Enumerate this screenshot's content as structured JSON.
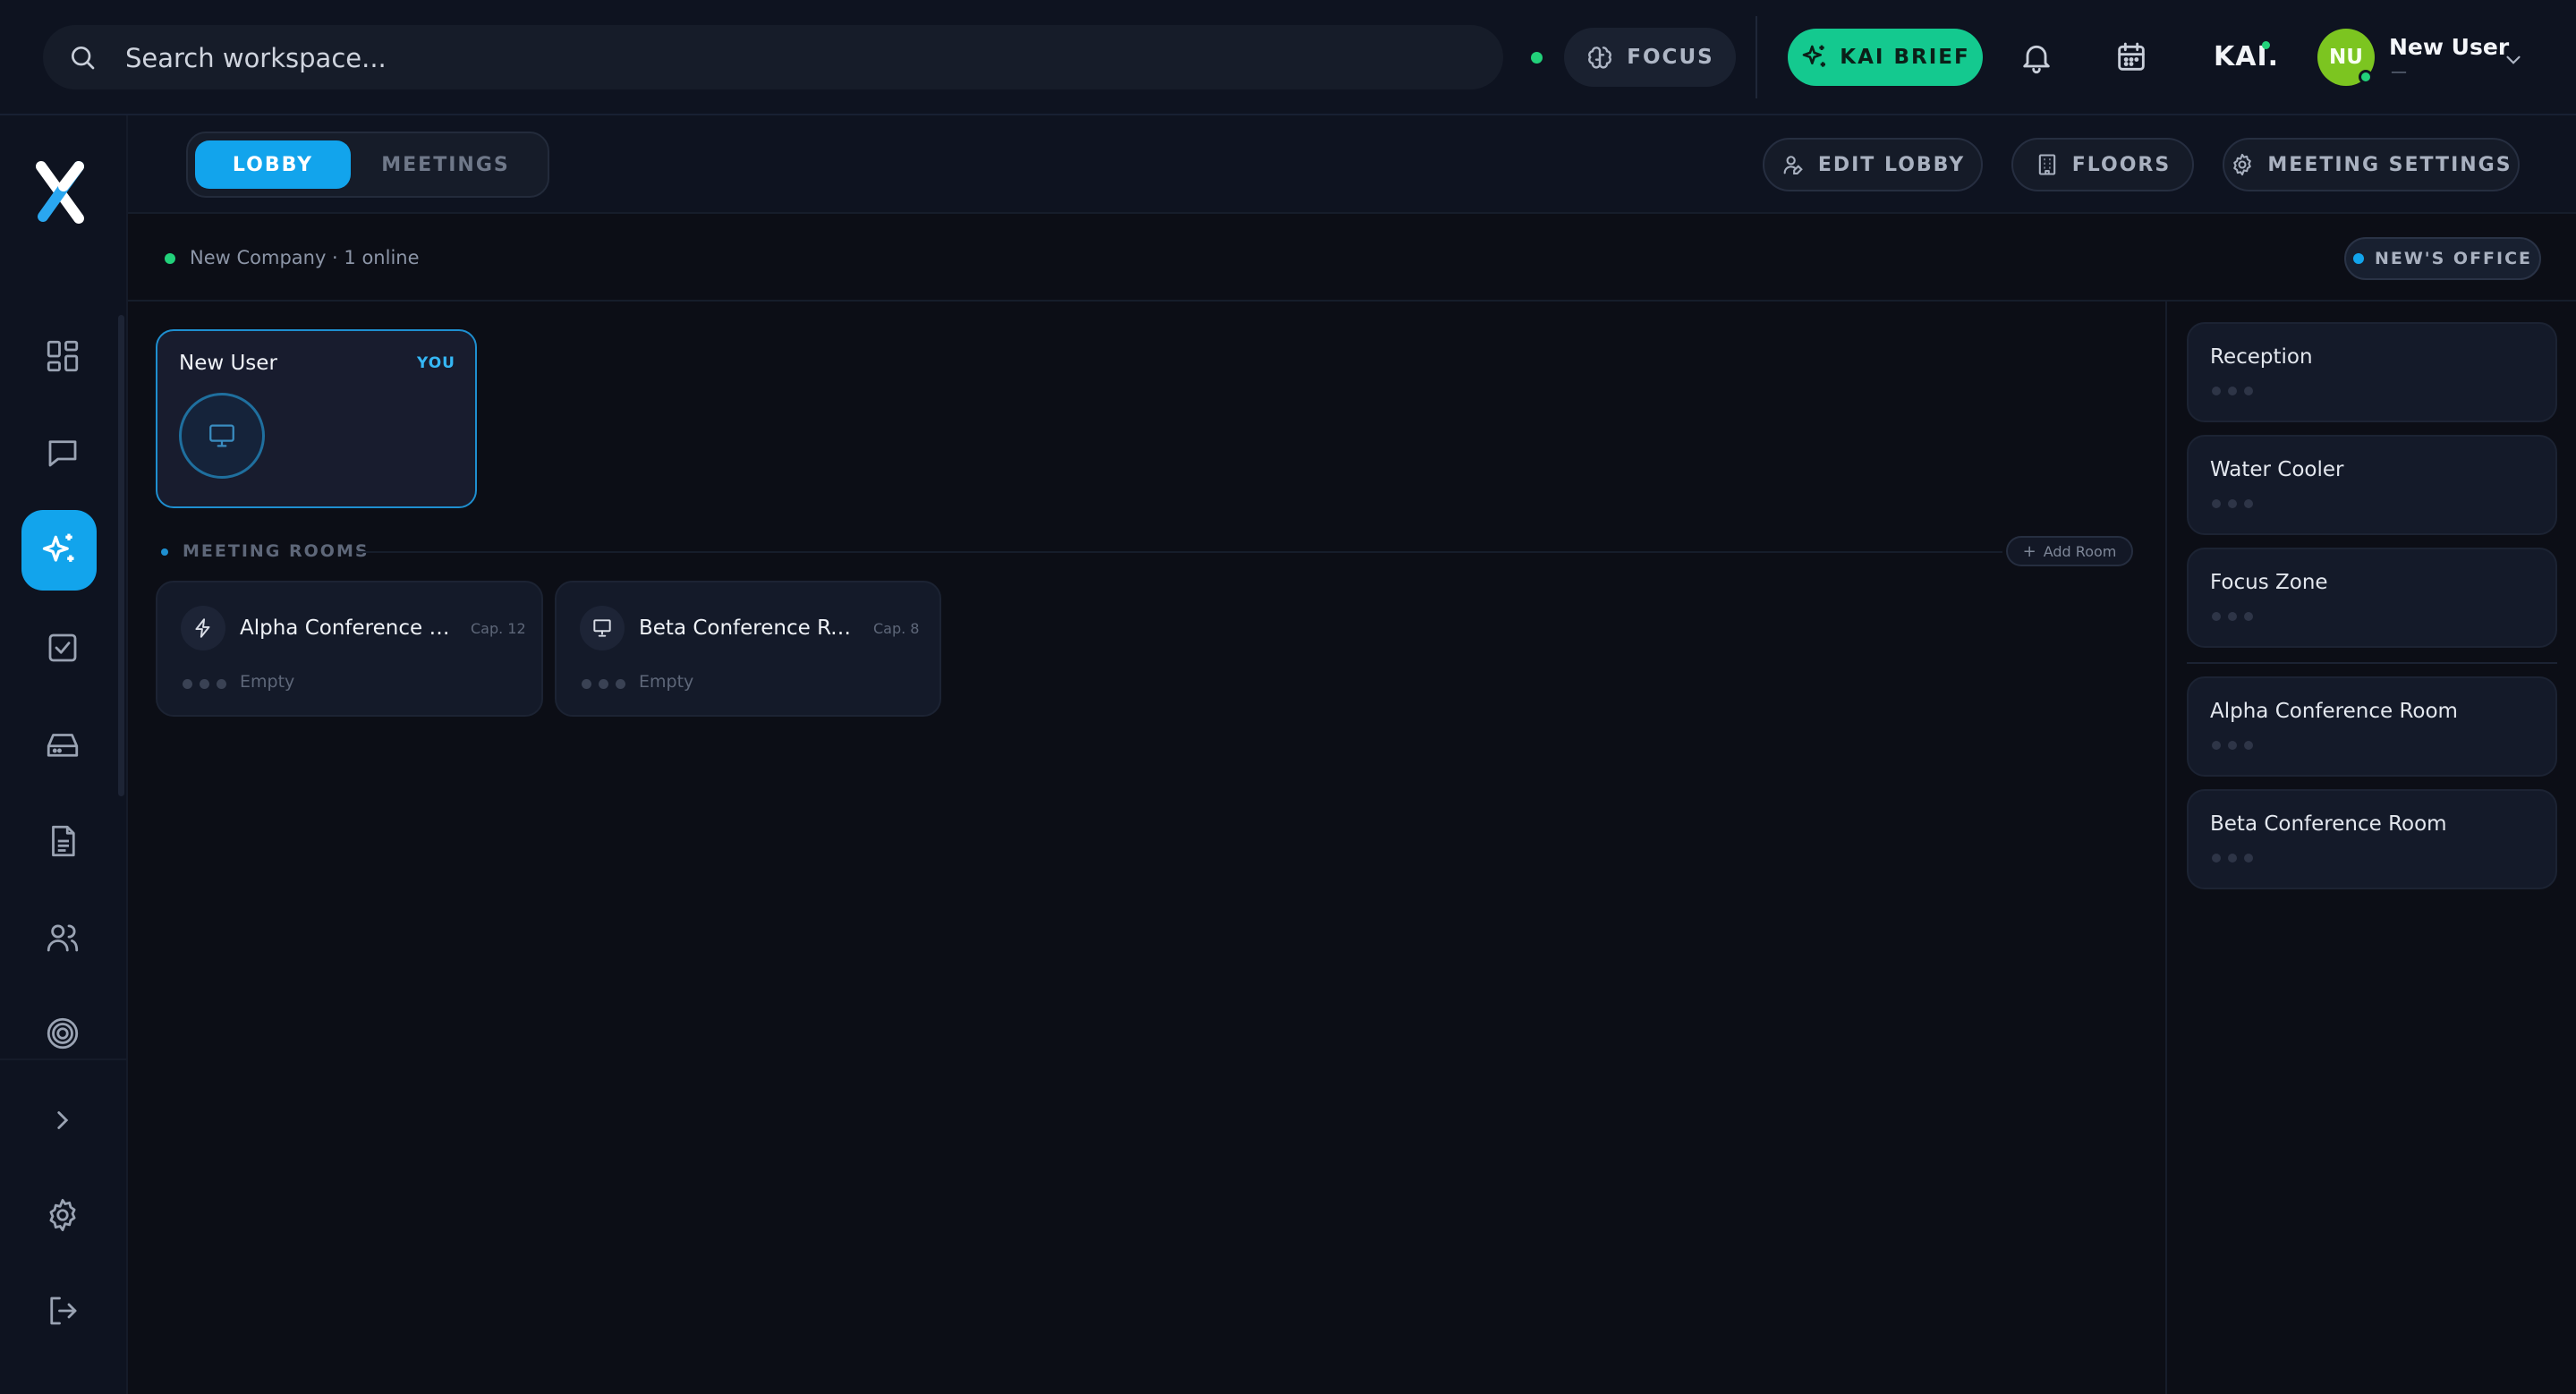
{
  "topbar": {
    "search_placeholder": "Search workspace...",
    "focus_label": "FOCUS",
    "kai_brief_label": "KAI BRIEF",
    "kai_logo": "KAI.",
    "user": {
      "initials": "NU",
      "name": "New User",
      "subtitle": "—"
    }
  },
  "sidebar": {
    "items": [
      {
        "icon": "dashboard-icon"
      },
      {
        "icon": "chat-icon"
      },
      {
        "icon": "sparkles-icon",
        "active": true
      },
      {
        "icon": "checkbox-icon"
      },
      {
        "icon": "inbox-icon"
      },
      {
        "icon": "document-icon"
      },
      {
        "icon": "users-icon"
      },
      {
        "icon": "target-icon"
      },
      {
        "icon": "chevron-right-icon"
      },
      {
        "icon": "gear-icon"
      },
      {
        "icon": "logout-icon"
      }
    ]
  },
  "tabs": {
    "lobby": "LOBBY",
    "meetings": "MEETINGS"
  },
  "toolbar": {
    "edit_lobby": "EDIT LOBBY",
    "floors": "FLOORS",
    "meeting_settings": "MEETING SETTINGS"
  },
  "company": {
    "status_text": "New Company · 1 online",
    "office_badge": "NEW'S OFFICE"
  },
  "user_card": {
    "name": "New User",
    "you_label": "YOU"
  },
  "meeting_rooms": {
    "title": "MEETING ROOMS",
    "add_room": "Add Room",
    "rooms": [
      {
        "name": "Alpha Conference Ro...",
        "capacity": "Cap. 12",
        "status": "Empty",
        "icon": "bolt-icon"
      },
      {
        "name": "Beta Conference Roo...",
        "capacity": "Cap. 8",
        "status": "Empty",
        "icon": "presentation-icon"
      }
    ]
  },
  "zones": [
    {
      "name": "Reception"
    },
    {
      "name": "Water Cooler"
    },
    {
      "name": "Focus Zone"
    },
    {
      "name": "Alpha Conference Room"
    },
    {
      "name": "Beta Conference Room"
    }
  ],
  "colors": {
    "accent": "#12a4ec",
    "kai_green": "#14c98f",
    "online": "#22d17a",
    "avatar": "#7cc520",
    "background": "#0c0e16"
  }
}
